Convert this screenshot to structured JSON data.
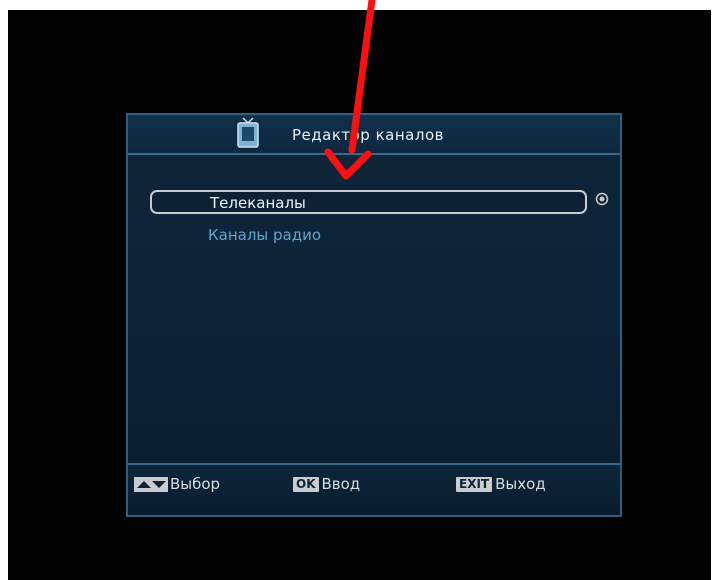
{
  "window": {
    "title": "Редактор каналов",
    "title_icon": "tv-icon"
  },
  "channel_types": {
    "items": [
      {
        "label": "Телеканалы",
        "selected": true
      },
      {
        "label": "Каналы радио",
        "selected": false
      }
    ],
    "scroll_icon": "scroll-dot-icon"
  },
  "footer": {
    "select_keys_icon": "up-down-arrows-icon",
    "select_label": "Выбор",
    "ok_key": "OK",
    "ok_label": "Ввод",
    "exit_key": "EXIT",
    "exit_label": "Выход"
  },
  "annotation": {
    "icon": "red-arrow-icon",
    "color": "#ff1010"
  },
  "colors": {
    "panel_bg": "#0c2236",
    "panel_border": "#2d5f7f",
    "selected_text": "#f2f4f6",
    "unselected_text": "#5ea6cf"
  }
}
